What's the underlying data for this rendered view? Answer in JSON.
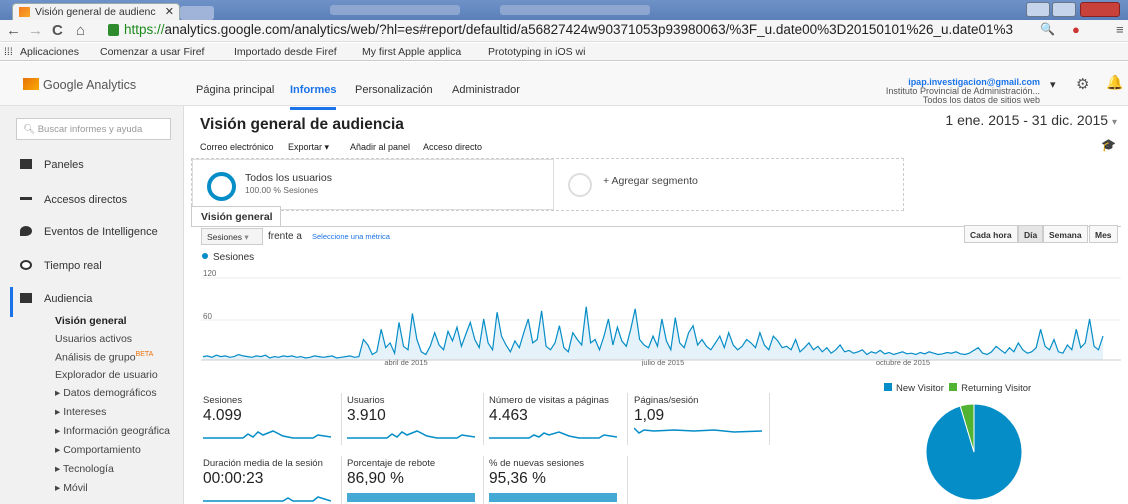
{
  "browser": {
    "tab_title": "Visión general de audienc",
    "url_scheme": "https://",
    "url_rest": "analytics.google.com/analytics/web/?hl=es#report/defaultid/a56827424w90371053p93980063/%3F_u.date00%3D20150101%26_u.date01%3",
    "bookmarks": [
      "Aplicaciones",
      "Comenzar a usar Firef",
      "Importado desde Firef",
      "My first Apple applica",
      "Prototyping in iOS wi"
    ]
  },
  "header": {
    "logo_text": "Google Analytics",
    "nav": [
      "Página principal",
      "Informes",
      "Personalización",
      "Administrador"
    ],
    "account_email": "ipap.investigacion@gmail.com",
    "account_org": "Instituto Provincial de Administración...",
    "account_view": "Todos los datos de sitios web"
  },
  "sidebar": {
    "search_placeholder": "Buscar informes y ayuda",
    "items": [
      "Paneles",
      "Accesos directos",
      "Eventos de Intelligence",
      "Tiempo real",
      "Audiencia"
    ],
    "audience_sub": [
      "Visión general",
      "Usuarios activos",
      "Análisis de grupo",
      "Explorador de usuario",
      "▸ Datos demográficos",
      "▸ Intereses",
      "▸ Información geográfica",
      "▸ Comportamiento",
      "▸ Tecnología",
      "▸ Móvil"
    ],
    "beta": "BETA"
  },
  "main": {
    "title": "Visión general de audiencia",
    "date_range": "1 ene. 2015 - 31 dic. 2015",
    "toolbar": [
      "Correo electrónico",
      "Exportar ▾",
      "Añadir al panel",
      "Acceso directo"
    ],
    "segment_name": "Todos los usuarios",
    "segment_sub": "100.00 % Sesiones",
    "add_segment": "+ Agregar segmento",
    "tab": "Visión general",
    "metric_select": "Sesiones",
    "versus": "frente a",
    "select_metric": "Seleccione una métrica",
    "granularity": [
      "Cada hora",
      "Día",
      "Semana",
      "Mes"
    ]
  },
  "chart_data": {
    "type": "line",
    "series": [
      {
        "name": "Sesiones",
        "values": [
          5,
          6,
          4,
          7,
          5,
          6,
          4,
          5,
          8,
          6,
          5,
          4,
          6,
          5,
          7,
          3,
          5,
          4,
          6,
          5,
          6,
          4,
          5,
          3,
          4,
          6,
          5,
          4,
          5,
          6,
          3,
          4,
          5,
          6,
          4,
          5,
          30,
          22,
          8,
          12,
          45,
          18,
          25,
          10,
          55,
          20,
          15,
          68,
          30,
          12,
          8,
          20,
          40,
          22,
          15,
          42,
          28,
          48,
          20,
          38,
          55,
          30,
          18,
          60,
          25,
          15,
          70,
          35,
          22,
          12,
          28,
          18,
          40,
          60,
          25,
          30,
          72,
          20,
          15,
          25,
          50,
          18,
          12,
          40,
          30,
          22,
          78,
          25,
          30,
          15,
          35,
          60,
          22,
          48,
          28,
          20,
          45,
          75,
          30,
          22,
          18,
          35,
          20,
          60,
          28,
          15,
          62,
          25,
          18,
          40,
          50,
          22,
          30,
          20,
          15,
          25,
          35,
          18,
          40,
          22,
          15,
          20,
          30,
          25,
          18,
          40,
          22,
          15,
          35,
          28,
          18,
          20,
          15,
          30,
          12,
          18,
          25,
          15,
          20,
          12,
          18,
          10,
          15,
          22,
          12,
          14,
          10,
          12,
          15,
          8,
          12,
          10,
          14,
          9,
          11,
          8,
          10,
          12,
          9,
          10,
          8,
          11,
          9,
          12,
          10,
          8,
          9,
          11,
          10,
          12,
          9,
          8,
          10,
          14,
          18,
          10,
          8,
          12,
          20,
          15,
          10,
          18,
          12,
          25,
          15,
          10,
          12,
          18,
          45,
          20,
          15,
          30,
          12,
          10,
          22,
          15,
          45,
          18,
          25,
          60,
          20,
          15,
          35
        ]
      }
    ],
    "x_labels": [
      "abril de 2015",
      "julio de 2015",
      "octubre de 2015"
    ],
    "y_ticks": [
      120,
      60
    ],
    "ylim": [
      0,
      120
    ],
    "legend": "Sesiones",
    "color": "#058dc7"
  },
  "stats": [
    {
      "label": "Sesiones",
      "value": "4.099"
    },
    {
      "label": "Usuarios",
      "value": "3.910"
    },
    {
      "label": "Número de visitas a páginas",
      "value": "4.463"
    },
    {
      "label": "Páginas/sesión",
      "value": "1,09"
    },
    {
      "label": "Duración media de la sesión",
      "value": "00:00:23"
    },
    {
      "label": "Porcentaje de rebote",
      "value": "86,90 %"
    },
    {
      "label": "% de nuevas sesiones",
      "value": "95,36 %"
    }
  ],
  "pie": {
    "type": "pie",
    "legend": [
      "New Visitor",
      "Returning Visitor"
    ],
    "values": [
      95.36,
      4.64
    ],
    "colors": [
      "#058dc7",
      "#50b432"
    ]
  }
}
